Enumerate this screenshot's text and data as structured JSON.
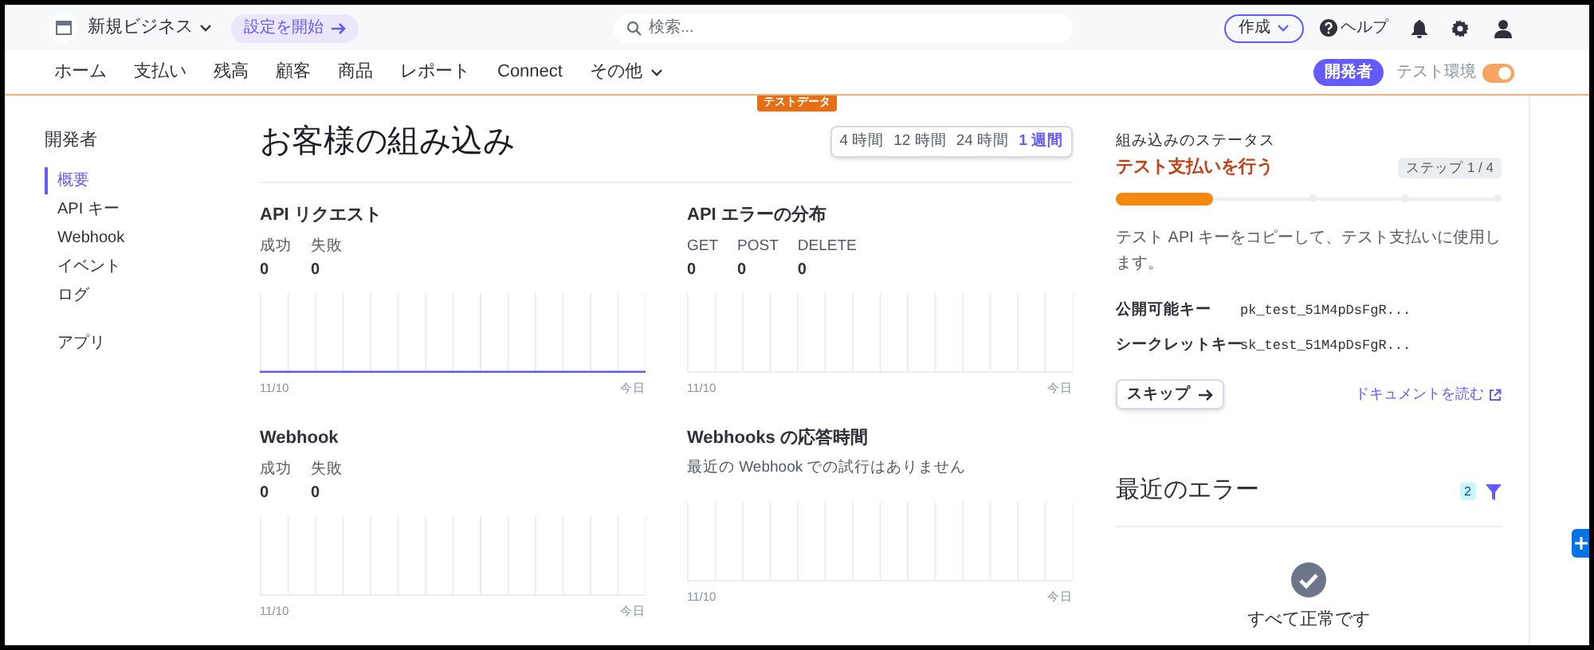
{
  "topbar": {
    "account": "新規ビジネス",
    "setup_button": "設定を開始",
    "search": {
      "placeholder": "検索..."
    },
    "create_button": "作成",
    "help": "ヘルプ"
  },
  "nav": {
    "items": [
      {
        "label": "ホーム"
      },
      {
        "label": "支払い"
      },
      {
        "label": "残高"
      },
      {
        "label": "顧客"
      },
      {
        "label": "商品"
      },
      {
        "label": "レポート"
      },
      {
        "label": "Connect"
      },
      {
        "label": "その他",
        "dropdown": true
      }
    ],
    "developer_badge": "開発者",
    "test_mode": {
      "label": "テスト環境",
      "on": true
    }
  },
  "test_data_badge": "テストデータ",
  "sidebar": {
    "title": "開発者",
    "items": [
      {
        "label": "概要",
        "selected": true
      },
      {
        "label": "API キー",
        "selected": false
      },
      {
        "label": "Webhook",
        "selected": false
      },
      {
        "label": "イベント",
        "selected": false
      },
      {
        "label": "ログ",
        "selected": false
      },
      {
        "label": "アプリ",
        "selected": false
      }
    ]
  },
  "page": {
    "title": "お客様の組み込み",
    "ranges": [
      {
        "label": "4 時間",
        "selected": false
      },
      {
        "label": "12 時間",
        "selected": false
      },
      {
        "label": "24 時間",
        "selected": false
      },
      {
        "label": "1 週間",
        "selected": true
      }
    ]
  },
  "panels": [
    {
      "title": "API リクエスト",
      "stats": [
        {
          "label": "成功",
          "value": "0"
        },
        {
          "label": "失敗",
          "value": "0"
        }
      ],
      "baseline": true,
      "start": "11/10",
      "end": "今日"
    },
    {
      "title": "API エラーの分布",
      "stats": [
        {
          "label": "GET",
          "value": "0"
        },
        {
          "label": "POST",
          "value": "0"
        },
        {
          "label": "DELETE",
          "value": "0"
        }
      ],
      "baseline": false,
      "start": "11/10",
      "end": "今日"
    },
    {
      "title": "Webhook",
      "stats": [
        {
          "label": "成功",
          "value": "0"
        },
        {
          "label": "失敗",
          "value": "0"
        }
      ],
      "baseline": false,
      "start": "11/10",
      "end": "今日"
    },
    {
      "title": "Webhooks の応答時間",
      "note": "最近の Webhook での試行はありません",
      "baseline": false,
      "start": "11/10",
      "end": "今日"
    }
  ],
  "integration": {
    "heading": "組み込みのステータス",
    "task": "テスト支払いを行う",
    "step": "ステップ 1 / 4",
    "level": 0.25,
    "description": "テスト API キーをコピーして、テスト支払いに使用します。",
    "keys": [
      {
        "label": "公開可能キー",
        "value": "pk_test_51M4pDsFgR..."
      },
      {
        "label": "シークレットキー",
        "value": "sk_test_51M4pDsFgR..."
      }
    ],
    "skip_button": "スキップ",
    "docs_link": "ドキュメントを読む"
  },
  "errors": {
    "title": "最近のエラー",
    "count": "2",
    "empty_title": "すべて正常です"
  }
}
